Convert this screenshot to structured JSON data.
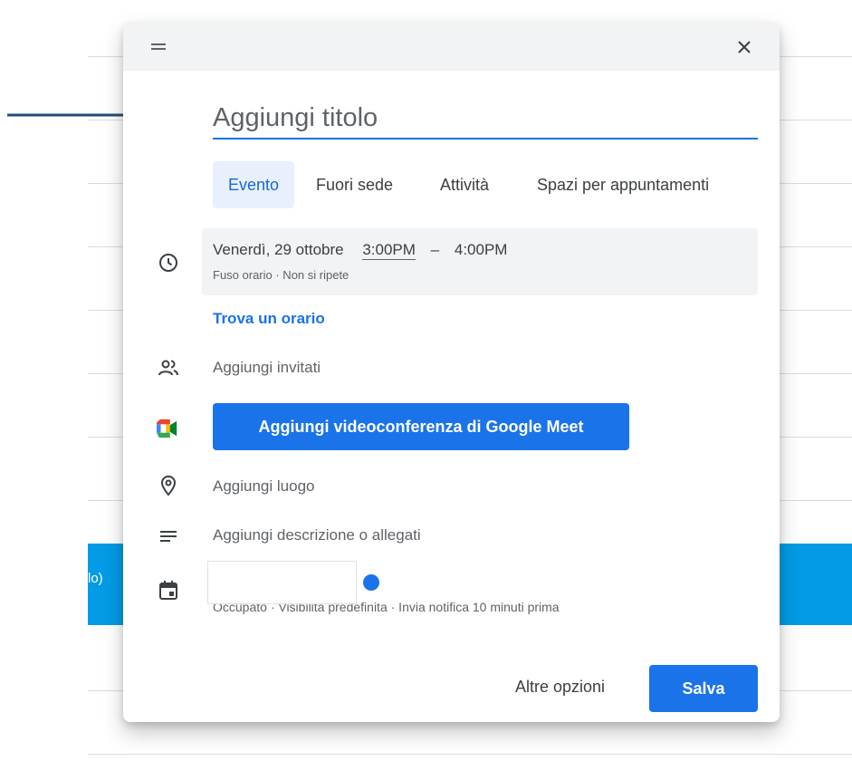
{
  "background": {
    "event_label": "lo)"
  },
  "dialog": {
    "title_placeholder": "Aggiungi titolo",
    "tabs": [
      {
        "label": "Evento",
        "active": true
      },
      {
        "label": "Fuori sede",
        "active": false
      },
      {
        "label": "Attività",
        "active": false
      },
      {
        "label": "Spazi per appuntamenti",
        "active": false
      }
    ],
    "datetime": {
      "date": "Venerdì, 29 ottobre",
      "start": "3:00PM",
      "separator": "–",
      "end": "4:00PM",
      "details": "Fuso orario · Non si ripete"
    },
    "find_time_link": "Trova un orario",
    "guests_label": "Aggiungi invitati",
    "meet_button": "Aggiungi videoconferenza di Google Meet",
    "location_label": "Aggiungi luogo",
    "description_label": "Aggiungi descrizione o allegati",
    "calendar_status": "Occupato · Visibilità predefinita · Invia notifica 10 minuti prima",
    "more_options": "Altre opzioni",
    "save": "Salva"
  },
  "icons": {
    "arrow": "right-arrow-annotation",
    "drag": "drag-handle-icon",
    "close": "close-icon",
    "clock": "clock-icon",
    "people": "people-icon",
    "meet": "google-meet-icon",
    "location": "location-pin-icon",
    "description": "notes-lines-icon",
    "calendar": "calendar-icon"
  },
  "colors": {
    "accent": "#1a73e8",
    "tab_active_bg": "#e8f0fe",
    "background_event": "#039be5",
    "arrow": "#1f4e79"
  }
}
